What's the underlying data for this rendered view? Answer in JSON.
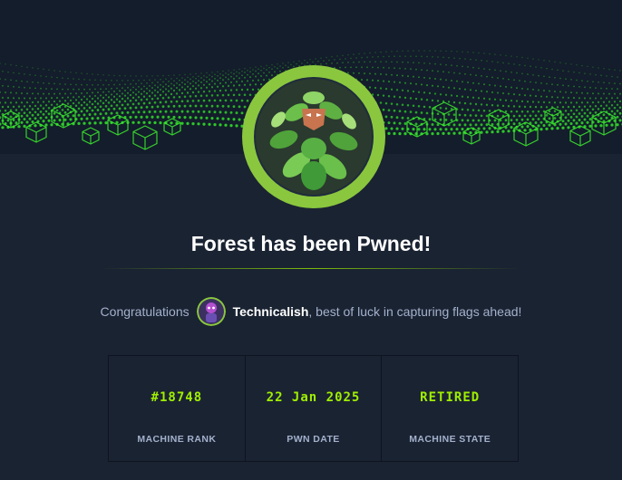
{
  "header": {
    "title": "Forest has been Pwned!"
  },
  "congrats": {
    "prefix": "Congratulations",
    "username": "Technicalish",
    "suffix": ", best of luck in capturing flags ahead!"
  },
  "stats": [
    {
      "value": "#18748",
      "label": "MACHINE RANK"
    },
    {
      "value": "22 Jan 2025",
      "label": "PWN DATE"
    },
    {
      "value": "RETIRED",
      "label": "MACHINE STATE"
    }
  ],
  "icons": {
    "machine": "forest-machine-icon",
    "user": "user-avatar-icon"
  },
  "colors": {
    "accent": "#9fef00",
    "background": "#1a2332",
    "banner": "#141d2b",
    "text_muted": "#a4b1cd"
  }
}
